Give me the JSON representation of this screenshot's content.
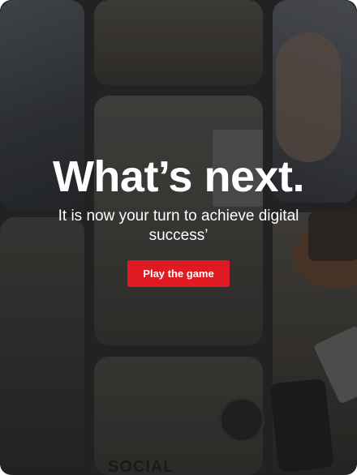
{
  "hero": {
    "headline": "What’s next.",
    "subtitle": "It is now your turn to achieve digital success’",
    "cta_label": "Play the game"
  },
  "collage": {
    "social_text": "SOCIAL"
  },
  "colors": {
    "cta_background": "#e01a22",
    "text": "#ffffff",
    "overlay": "#191919"
  }
}
